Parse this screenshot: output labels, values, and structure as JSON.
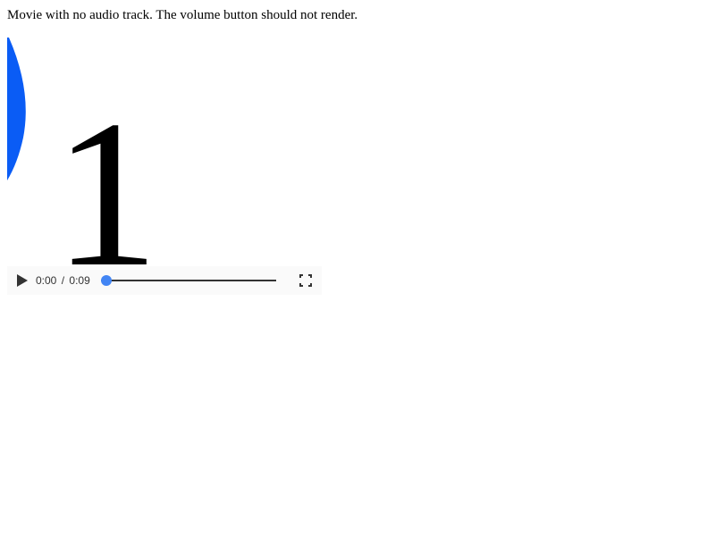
{
  "caption": "Movie with no audio track. The volume button should not render.",
  "video": {
    "frame_digit": "1",
    "accent_color": "#0a5cf5",
    "controls": {
      "play_icon": "play-icon",
      "current_time": "0:00",
      "separator": "/",
      "duration": "0:09",
      "progress": 0.0,
      "thumb_color": "#4285f4",
      "fullscreen_icon": "fullscreen-icon"
    }
  }
}
